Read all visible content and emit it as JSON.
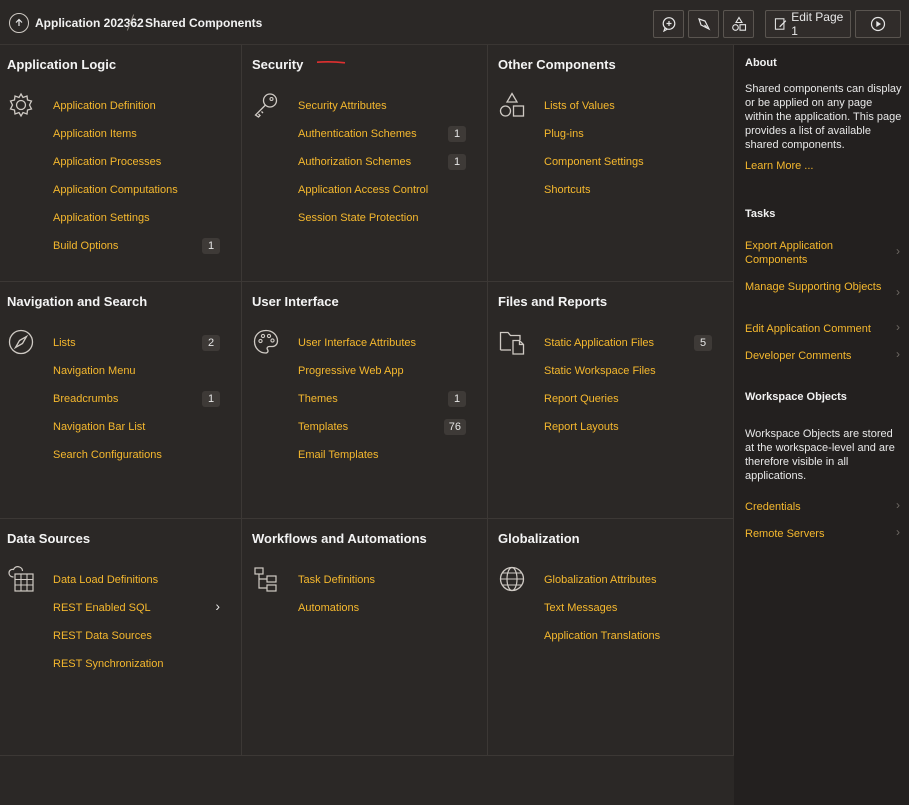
{
  "breadcrumb": {
    "app": "Application 202362",
    "page": "Shared Components"
  },
  "toolbar": {
    "edit_page_label": "Edit Page 1"
  },
  "panels": {
    "app_logic": {
      "title": "Application Logic",
      "items": [
        "Application Definition",
        "Application Items",
        "Application Processes",
        "Application Computations",
        "Application Settings",
        "Build Options"
      ],
      "badges": {
        "build_options": "1"
      }
    },
    "security": {
      "title": "Security",
      "items": [
        "Security Attributes",
        "Authentication Schemes",
        "Authorization Schemes",
        "Application Access Control",
        "Session State Protection"
      ],
      "badges": {
        "authentication": "1",
        "authorization": "1"
      }
    },
    "other": {
      "title": "Other Components",
      "items": [
        "Lists of Values",
        "Plug-ins",
        "Component Settings",
        "Shortcuts"
      ]
    },
    "navigation": {
      "title": "Navigation and Search",
      "items": [
        "Lists",
        "Navigation Menu",
        "Breadcrumbs",
        "Navigation Bar List",
        "Search Configurations"
      ],
      "badges": {
        "lists": "2",
        "breadcrumbs": "1"
      }
    },
    "ui": {
      "title": "User Interface",
      "items": [
        "User Interface Attributes",
        "Progressive Web App",
        "Themes",
        "Templates",
        "Email Templates"
      ],
      "badges": {
        "themes": "1",
        "templates": "76"
      }
    },
    "files": {
      "title": "Files and Reports",
      "items": [
        "Static Application Files",
        "Static Workspace Files",
        "Report Queries",
        "Report Layouts"
      ],
      "badges": {
        "static_app_files": "5"
      }
    },
    "data_sources": {
      "title": "Data Sources",
      "items": [
        "Data Load Definitions",
        "REST Enabled SQL",
        "REST Data Sources",
        "REST Synchronization"
      ]
    },
    "workflows": {
      "title": "Workflows and Automations",
      "items": [
        "Task Definitions",
        "Automations"
      ]
    },
    "globalization": {
      "title": "Globalization",
      "items": [
        "Globalization Attributes",
        "Text Messages",
        "Application Translations"
      ]
    }
  },
  "sidebar": {
    "about_title": "About",
    "about_text": "Shared components can display or be applied on any page within the application. This page provides a list of available shared components.",
    "learn_more": "Learn More ...",
    "tasks_title": "Tasks",
    "tasks": [
      "Export Application Components",
      "Manage Supporting Objects",
      "Edit Application Comment",
      "Developer Comments"
    ],
    "workspace_title": "Workspace Objects",
    "workspace_text": "Workspace Objects are stored at the workspace-level and are therefore visible in all applications.",
    "workspace_links": [
      "Credentials",
      "Remote Servers"
    ]
  },
  "icons": {
    "up": "arrow-up-icon",
    "add_comment": "add-comment-icon",
    "bug": "bug-icon",
    "shared": "shapes-icon",
    "edit": "edit-page-icon",
    "run": "run-icon",
    "gear": "gear-icon",
    "key": "key-icon",
    "shapes": "shapes-icon",
    "compass": "compass-icon",
    "palette": "palette-icon",
    "folder": "folder-file-icon",
    "database": "database-icon",
    "tree": "tree-icon",
    "globe": "globe-icon"
  },
  "colors": {
    "background": "#2b2826",
    "sidebar": "#23201f",
    "link": "#f5b82e",
    "accent_mark": "#e03030"
  }
}
